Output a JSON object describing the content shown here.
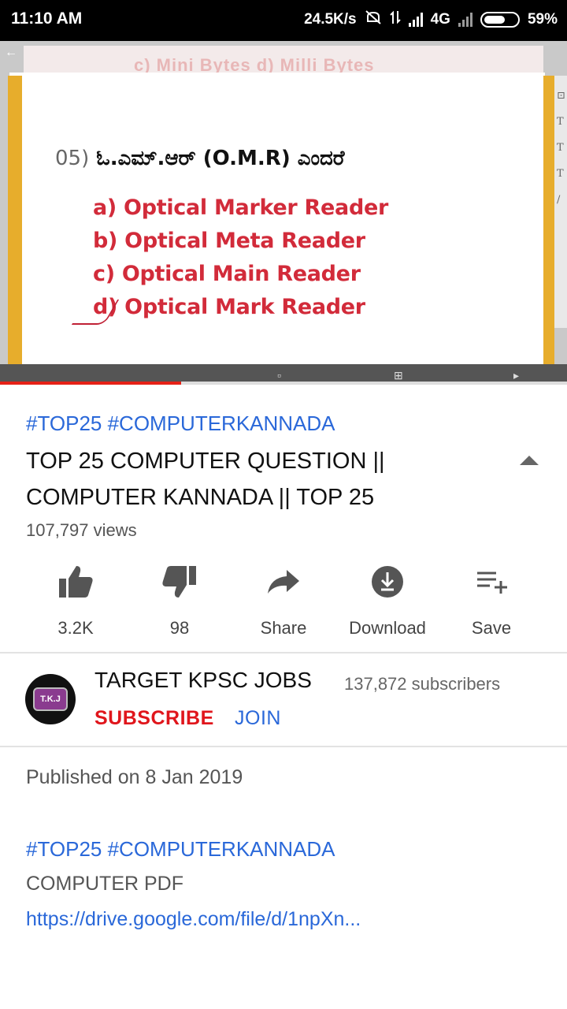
{
  "status_bar": {
    "time": "11:10 AM",
    "speed": "24.5K/s",
    "network": "4G",
    "battery": "59%"
  },
  "video": {
    "top_strip_text": "c) Mini Bytes    d) Milli Bytes",
    "question_number": "05)",
    "question_text": "ಓ.ಎಮ್.ಆರ್ (O.M.R) ಎಂದರೆ",
    "options": [
      "a) Optical Marker Reader",
      "b) Optical Meta Reader",
      "c) Optical Main Reader",
      "d) Optical Mark Reader"
    ],
    "progress_fraction": 0.32
  },
  "info": {
    "hashtags": "#TOP25 #COMPUTERKANNADA",
    "title": "TOP 25 COMPUTER QUESTION || COMPUTER KANNADA || TOP 25",
    "views": "107,797 views"
  },
  "actions": {
    "like": "3.2K",
    "dislike": "98",
    "share": "Share",
    "download": "Download",
    "save": "Save"
  },
  "channel": {
    "name": "TARGET KPSC JOBS",
    "subscribers": "137,872 subscribers",
    "subscribe": "SUBSCRIBE",
    "join": "JOIN",
    "avatar_text": "T.K.J"
  },
  "description": {
    "published": "Published on 8 Jan 2019",
    "hashtags": "#TOP25 #COMPUTERKANNADA",
    "line1": "COMPUTER PDF",
    "link": "https://drive.google.com/file/d/1npXn..."
  },
  "colors": {
    "accent_red": "#e0161c",
    "link_blue": "#2a68d9"
  }
}
